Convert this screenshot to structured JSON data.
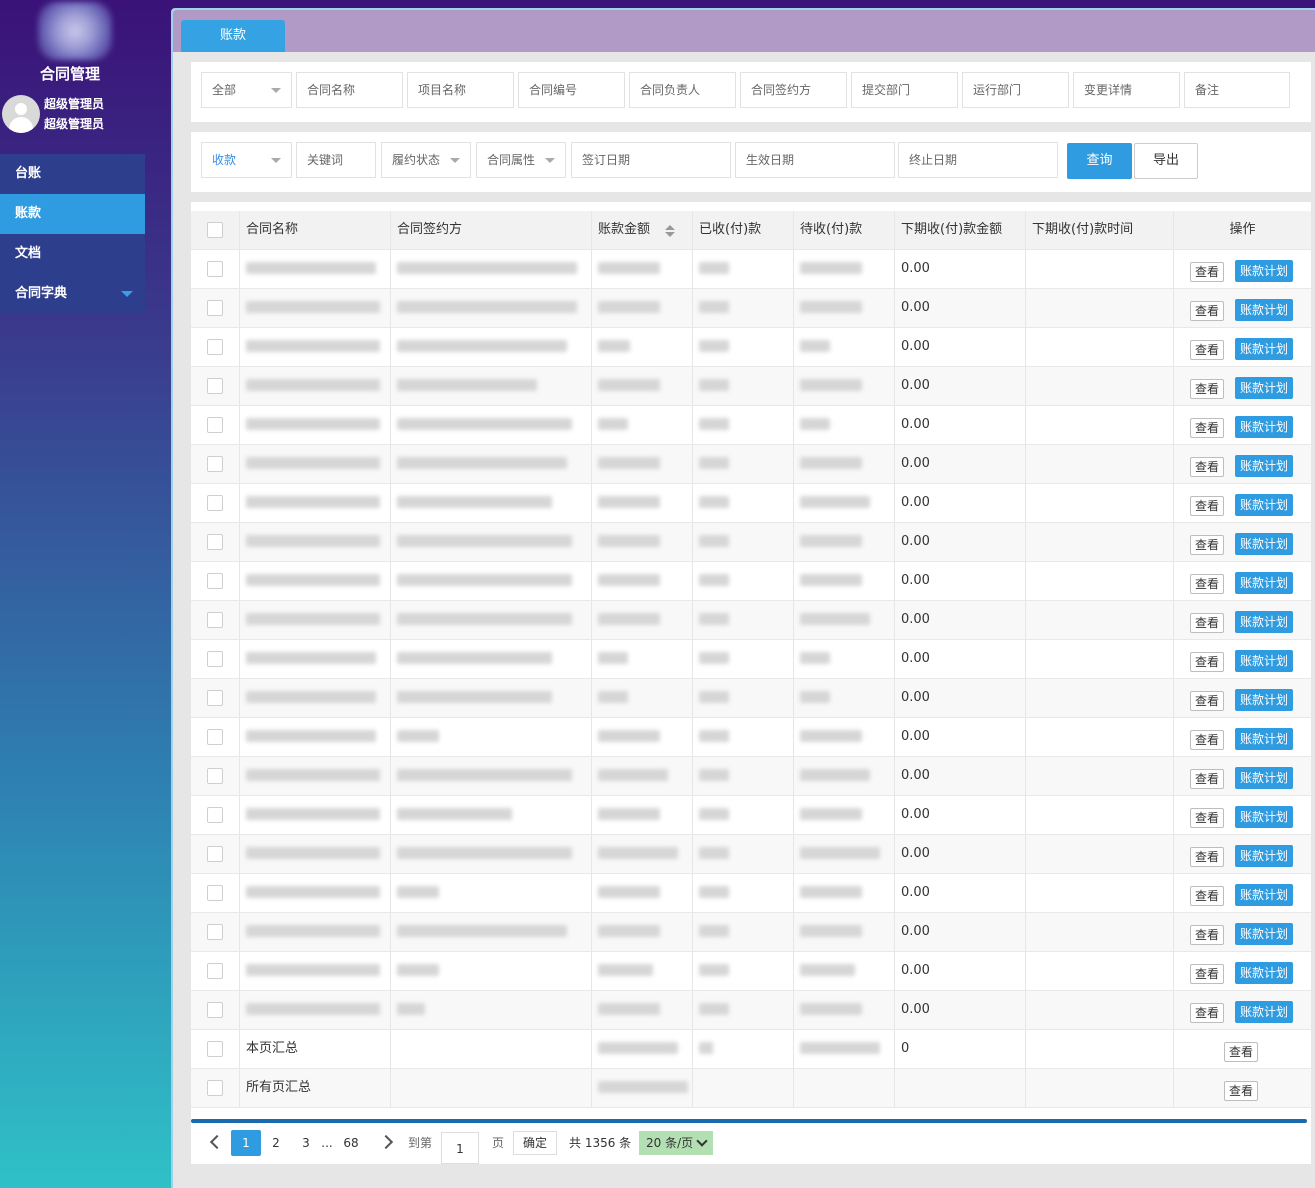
{
  "sidebar": {
    "app_title": "合同管理",
    "user_role": "超级管理员",
    "user_name": "超级管理员",
    "menu": [
      {
        "label": "台账",
        "active": false
      },
      {
        "label": "账款",
        "active": true
      },
      {
        "label": "文档",
        "active": false
      },
      {
        "label": "合同字典",
        "active": false,
        "has_caret": true
      }
    ]
  },
  "tab": {
    "label": "账款"
  },
  "filters_row1": {
    "scope": "全部",
    "contract_name": "合同名称",
    "project_name": "项目名称",
    "contract_no": "合同编号",
    "owner": "合同负责人",
    "counterparty": "合同签约方",
    "submit_dept": "提交部门",
    "run_dept": "运行部门",
    "change_detail": "变更详情",
    "remark": "备注"
  },
  "filters_row2": {
    "type": "收款",
    "keyword": "关键词",
    "perform_status": "履约状态",
    "contract_attr": "合同属性",
    "sign_date": "签订日期",
    "effective_date": "生效日期",
    "end_date": "终止日期",
    "query_label": "查询",
    "export_label": "导出"
  },
  "table": {
    "headers": {
      "name": "合同名称",
      "party": "合同签约方",
      "amount": "账款金额",
      "received": "已收(付)款",
      "pending": "待收(付)款",
      "next_amount": "下期收(付)款金额",
      "next_time": "下期收(付)款时间",
      "ops": "操作"
    },
    "next_amount_value": "0.00",
    "view_label": "查看",
    "plan_label": "账款计划",
    "page_total_label": "本页汇总",
    "page_total_next": "0",
    "all_total_label": "所有页汇总"
  },
  "pager": {
    "pages": [
      "1",
      "2",
      "3",
      "...",
      "68"
    ],
    "goto_label": "到第",
    "goto_value": "1",
    "page_unit": "页",
    "ok_label": "确定",
    "total_label": "共 1356 条",
    "size_label": "20 条/页"
  }
}
